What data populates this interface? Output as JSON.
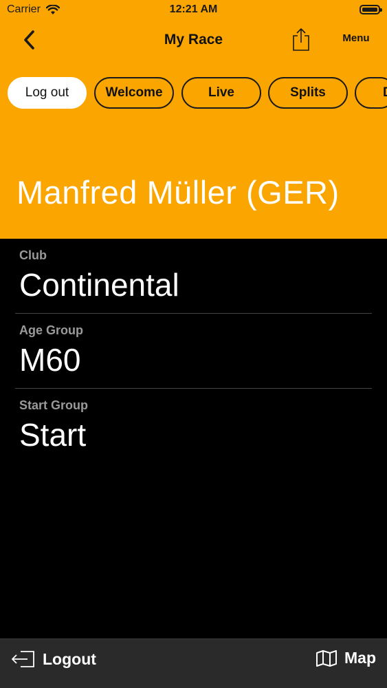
{
  "status_bar": {
    "carrier": "Carrier",
    "time": "12:21 AM",
    "wifi_icon": "wifi-icon",
    "battery_icon": "battery-icon"
  },
  "navbar": {
    "back_icon": "chevron-left-icon",
    "title": "My Race",
    "share_icon": "share-icon",
    "menu_label": "Menu"
  },
  "tabs": [
    {
      "label": "Log out",
      "active": true
    },
    {
      "label": "Welcome",
      "active": false
    },
    {
      "label": "Live",
      "active": false
    },
    {
      "label": "Splits",
      "active": false
    },
    {
      "label": "D",
      "active": false
    }
  ],
  "athlete": {
    "name": "Manfred Müller (GER)"
  },
  "info": [
    {
      "label": "Club",
      "value": "Continental"
    },
    {
      "label": "Age Group",
      "value": "M60"
    },
    {
      "label": "Start Group",
      "value": "Start"
    }
  ],
  "bottom_bar": {
    "logout_label": "Logout",
    "logout_icon": "logout-icon",
    "map_label": "Map",
    "map_icon": "map-icon"
  },
  "colors": {
    "accent": "#FBA500",
    "background": "#000000",
    "bottom_bar": "#2a2a2a",
    "label_gray": "#9a9a9a"
  }
}
